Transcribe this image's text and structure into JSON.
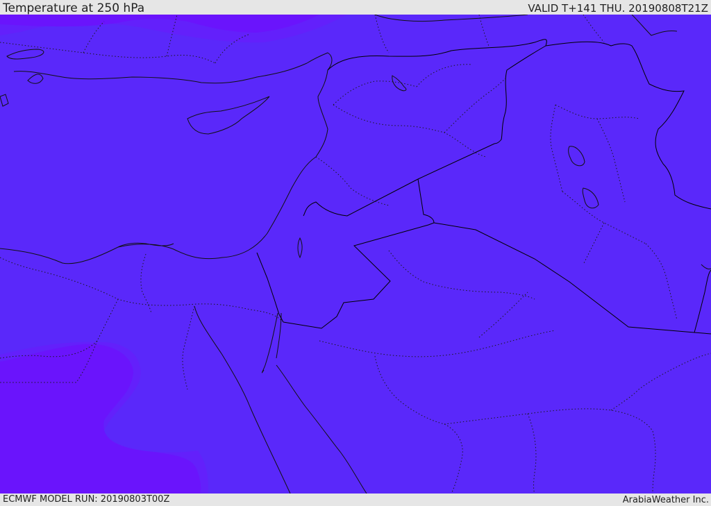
{
  "header": {
    "title": "Temperature at 250 hPa",
    "valid_time": "VALID T+141 THU. 20190808T21Z"
  },
  "footer": {
    "model_run": "ECMWF MODEL RUN: 20190803T00Z",
    "credit": "ArabiaWeather Inc."
  },
  "map": {
    "variable": "temperature",
    "level": "250 hPa",
    "colors": {
      "base_fill": "#5a28fa",
      "cold_band_fill": "#6a14fc",
      "transition_fill": "#6320fb",
      "coastline": "#111111",
      "border_country": "#000000",
      "border_internal": "#1a1a1a"
    }
  }
}
